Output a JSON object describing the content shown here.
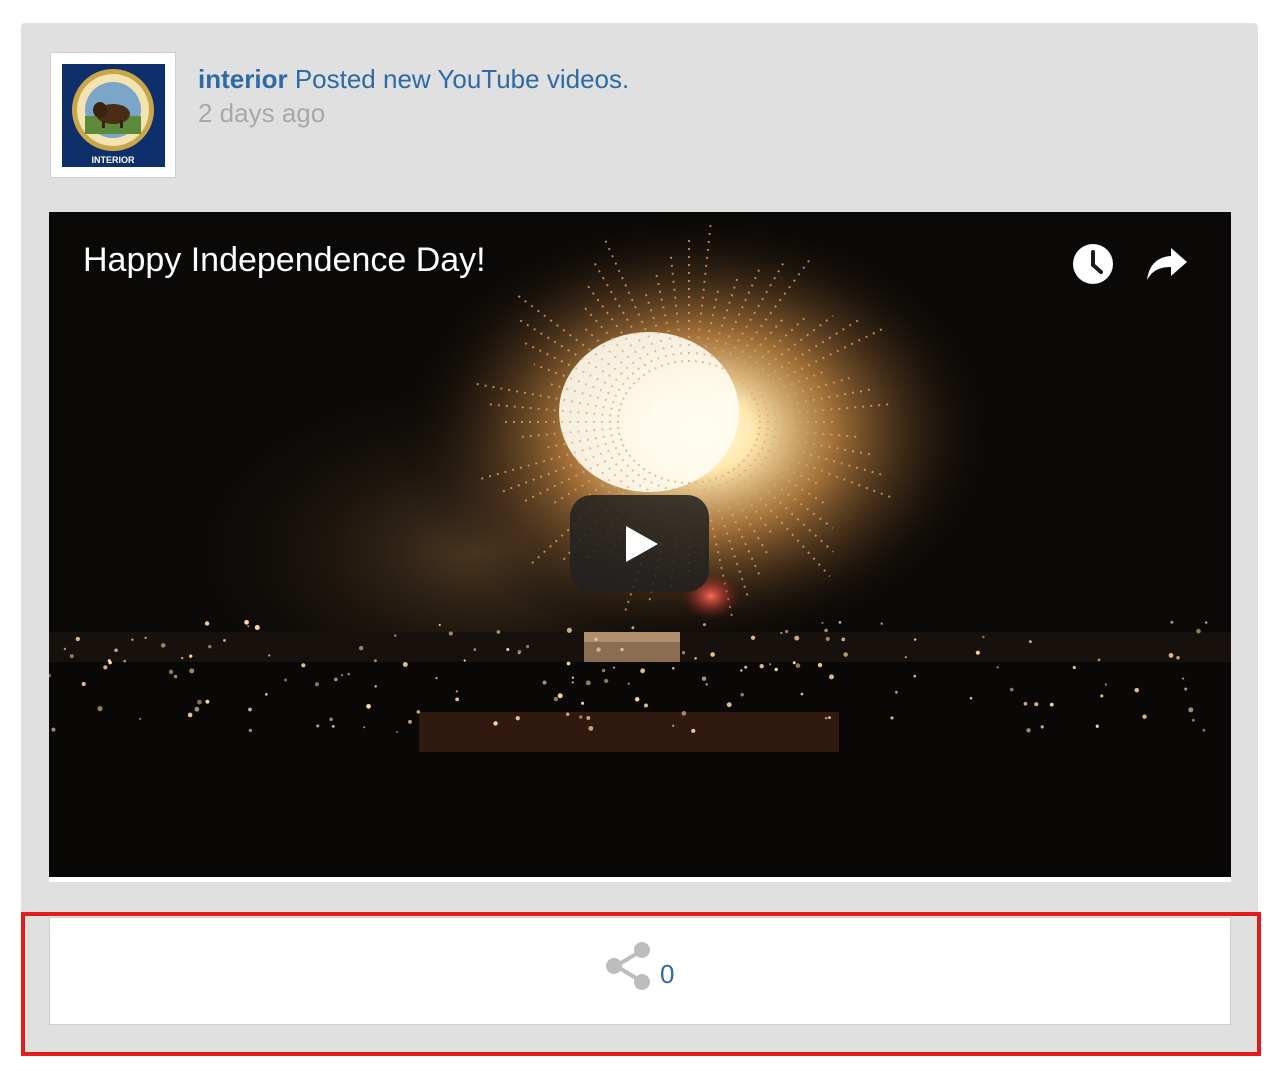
{
  "post": {
    "author": "interior",
    "action": "Posted new YouTube videos.",
    "time": "2 days ago",
    "avatar_icon": "interior-seal-icon",
    "avatar_caption": "INTERIOR"
  },
  "video": {
    "title": "Happy Independence Day!",
    "watch_later_icon": "clock-icon",
    "share_icon": "share-arrow-icon",
    "play_icon": "play-icon"
  },
  "share": {
    "icon": "share-nodes-icon",
    "count": "0"
  },
  "colors": {
    "link": "#2d6aa6",
    "muted": "#a8a8a8",
    "card_bg": "#e0e0e0",
    "highlight": "#e31b1b"
  }
}
